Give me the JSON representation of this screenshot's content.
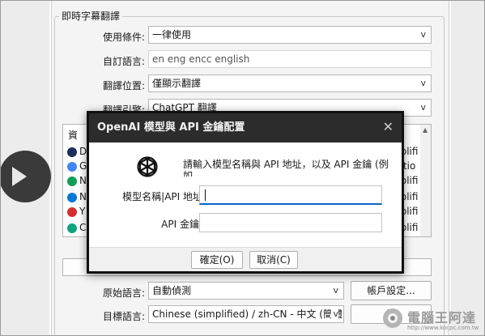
{
  "settings": {
    "group_title": "即時字幕翻譯",
    "use_condition": {
      "label": "使用條件:",
      "value": "一律使用"
    },
    "custom_language": {
      "label": "自訂語言:",
      "value": "en eng encc english"
    },
    "translate_position": {
      "label": "翻譯位置:",
      "value": "僅顯示翻譯"
    },
    "translate_engine": {
      "label": "翻譯引擎:",
      "value": "ChatGPT 翻譯"
    },
    "source_language": {
      "label": "原始語言:",
      "value": "自動偵測"
    },
    "target_language": {
      "label": "目標語言:",
      "value": "Chinese (simplified) / zh-CN - 中文 (簡體"
    },
    "account_button": "帳戶設定...",
    "target_button_partial": "資"
  },
  "engine_list": {
    "header": "資",
    "items": [
      {
        "letter": "D",
        "color": "#1b2d5c",
        "suffix": "nplifi"
      },
      {
        "letter": "G",
        "color": "#4285f4",
        "suffix": "ditio"
      },
      {
        "letter": "N",
        "color": "#0f9d58",
        "suffix": "nplifi"
      },
      {
        "letter": "N",
        "color": "#0078d4",
        "suffix": "nplifi"
      },
      {
        "letter": "Y",
        "color": "#d32f2f",
        "suffix": "nplifi"
      },
      {
        "letter": "C",
        "color": "#10a37f",
        "suffix": "nplifi"
      }
    ]
  },
  "dialog": {
    "title": "OpenAI 模型與 API 金鑰配置",
    "message": "請輸入模型名稱與 API 地址，以及 API 金鑰 (例如",
    "model_label": "模型名稱|API 地址",
    "model_value": "",
    "key_label": "API 金鑰:",
    "key_value": "",
    "ok_label": "確定(O)",
    "cancel_label": "取消(C)",
    "close_glyph": "✕"
  },
  "watermark": {
    "text": "電腦王阿達",
    "sub": "http://www.kocpc.com.tw"
  }
}
